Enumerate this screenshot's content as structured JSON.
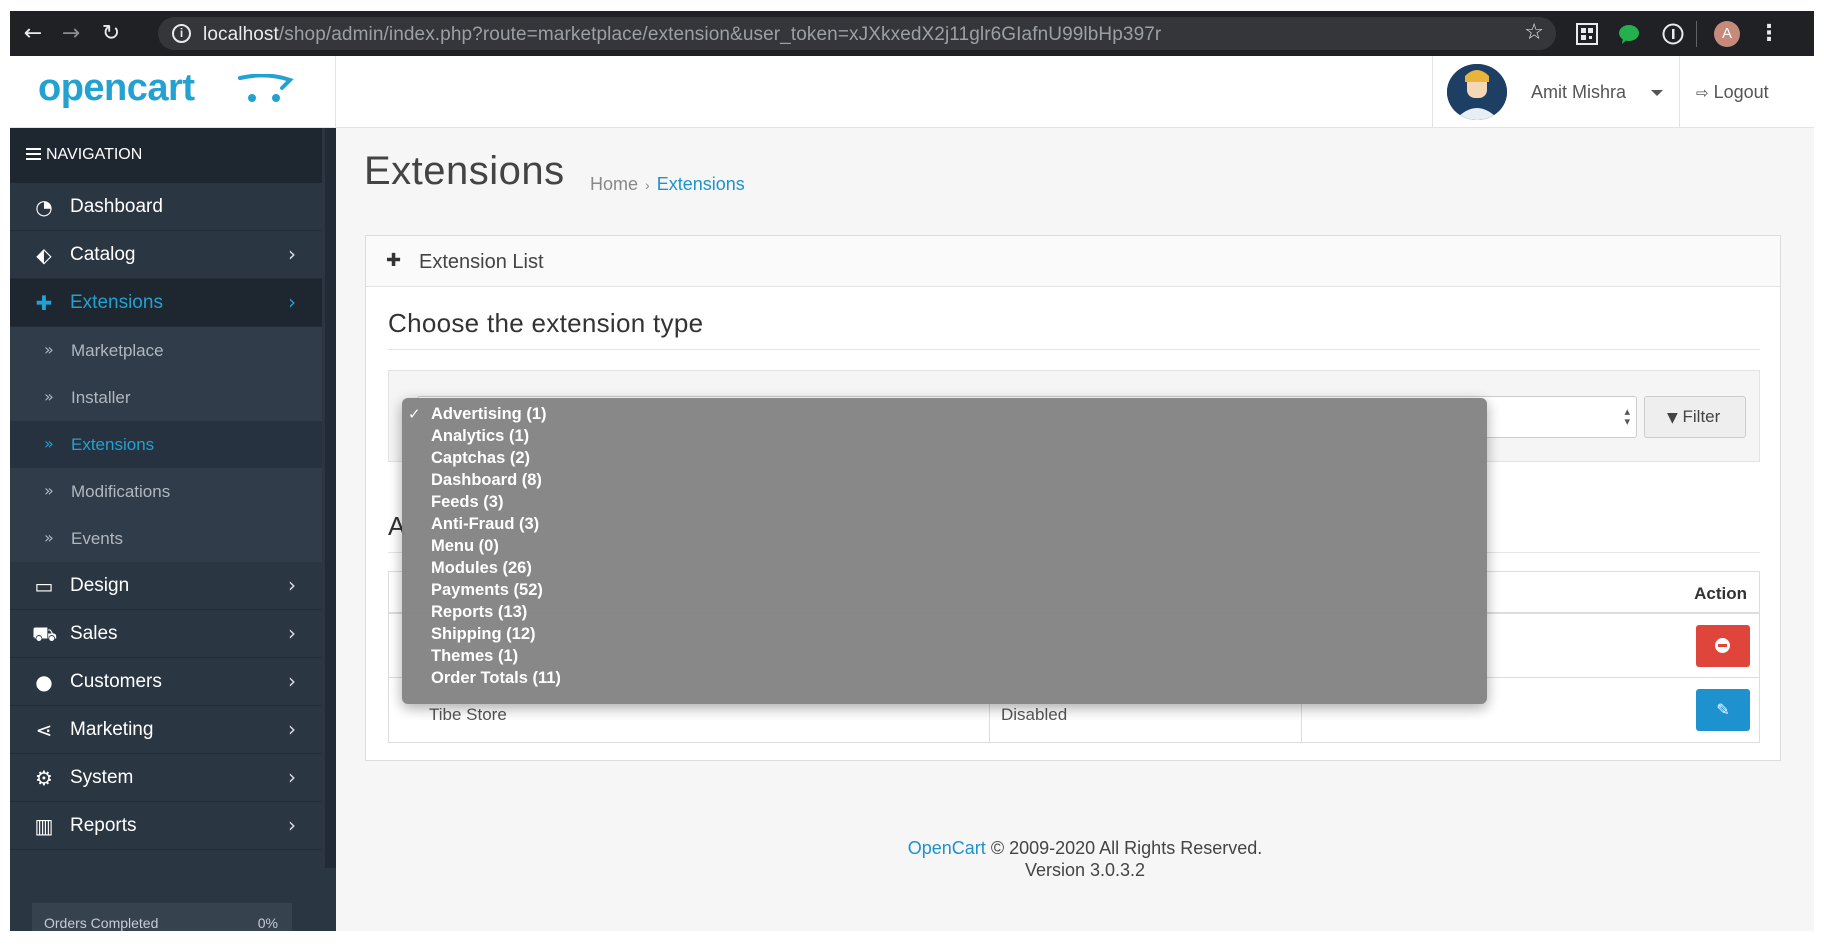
{
  "browser": {
    "url_host": "localhost",
    "url_path": "/shop/admin/index.php?route=marketplace/extension&user_token=xJXkxedX2j11glr6GIafnU99lbHp397r",
    "profile_initial": "A"
  },
  "header": {
    "logo": "opencart",
    "user_name": "Amit Mishra",
    "logout_label": "Logout"
  },
  "sidebar": {
    "nav_label": "NAVIGATION",
    "items": [
      {
        "label": "Dashboard",
        "icon": "dashboard-icon"
      },
      {
        "label": "Catalog",
        "icon": "tags-icon"
      },
      {
        "label": "Extensions",
        "icon": "puzzle-icon",
        "active": true
      },
      {
        "label": "Design",
        "icon": "monitor-icon"
      },
      {
        "label": "Sales",
        "icon": "cart-icon"
      },
      {
        "label": "Customers",
        "icon": "user-icon"
      },
      {
        "label": "Marketing",
        "icon": "share-icon"
      },
      {
        "label": "System",
        "icon": "gear-icon"
      },
      {
        "label": "Reports",
        "icon": "bar-chart-icon"
      }
    ],
    "sub_items": [
      {
        "label": "Marketplace"
      },
      {
        "label": "Installer"
      },
      {
        "label": "Extensions",
        "active": true
      },
      {
        "label": "Modifications"
      },
      {
        "label": "Events"
      }
    ],
    "progress": {
      "label": "Orders Completed",
      "value": "0%"
    }
  },
  "page": {
    "title": "Extensions",
    "breadcrumb": [
      "Home",
      "Extensions"
    ]
  },
  "panel": {
    "heading": "Extension List",
    "section_title": "Choose the extension type",
    "filter_label": "Filter",
    "partial_heading": "A",
    "table": {
      "action_header": "Action",
      "row2_partial_name": "Tibe Store",
      "row2_partial_status": "Disabled"
    }
  },
  "dropdown": {
    "selected": "Advertising (1)",
    "options": [
      "Advertising (1)",
      "Analytics (1)",
      "Captchas (2)",
      "Dashboard (8)",
      "Feeds (3)",
      "Anti-Fraud (3)",
      "Menu (0)",
      "Modules (26)",
      "Payments (52)",
      "Reports (13)",
      "Shipping (12)",
      "Themes (1)",
      "Order Totals (11)"
    ]
  },
  "footer": {
    "brand": "OpenCart",
    "copyright": "© 2009-2020 All Rights Reserved.",
    "version": "Version 3.0.3.2"
  },
  "colors": {
    "accent": "#1e91cf",
    "sidebar_bg": "#2b3643",
    "danger": "#e0453c",
    "dropdown_bg": "#858585"
  }
}
